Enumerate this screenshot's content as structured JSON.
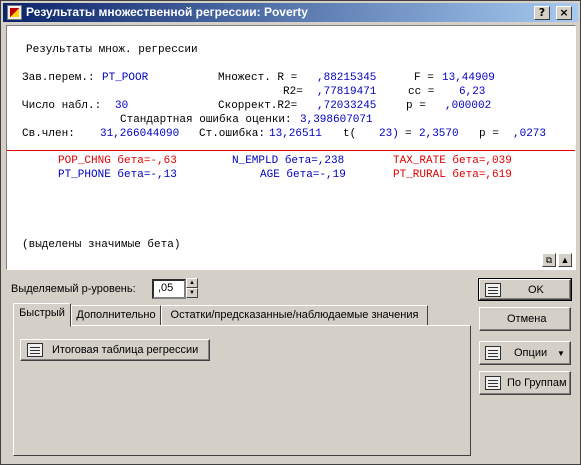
{
  "window": {
    "title": "Результаты множественной регрессии: Poverty"
  },
  "titlebar_buttons": {
    "help": "?",
    "close": "×"
  },
  "report": {
    "heading": "Результаты множ. регрессии",
    "dep_var_label": "Зав.перем.:",
    "dep_var_value": "PT_POOR",
    "multiple_r_label": "Множест. R =",
    "multiple_r_value": ",88215345",
    "f_label": "F =",
    "f_value": "13,44909",
    "r2_label": "R2=",
    "r2_value": ",77819471",
    "df_label": "cc =",
    "df_value": "6,23",
    "n_label": "Число набл.:",
    "n_value": "30",
    "adj_r2_label": "Скоррект.R2=",
    "adj_r2_value": ",72033245",
    "p_label": "p =",
    "p_value": ",000002",
    "std_err_label": "Стандартная ошибка оценки:",
    "std_err_value": "3,398607071",
    "intercept_label": "Св.член:",
    "intercept_value": "31,266044090",
    "intercept_se_label": "Ст.ошибка:",
    "intercept_se_value": "13,26511",
    "t_label": "t(",
    "t_df": "23)",
    "t_eq": "=",
    "t_value": "2,3570",
    "p2_label": "p =",
    "p2_value": ",0273",
    "betas_row1": [
      {
        "var": "POP_CHNG",
        "text": "бета=-,63",
        "significant": true
      },
      {
        "var": "N_EMPLD",
        "text": "бета=,238",
        "significant": false
      },
      {
        "var": "TAX_RATE",
        "text": "бета=,039",
        "significant": true
      }
    ],
    "betas_row2": [
      {
        "var": "PT_PHONE",
        "text": "бета=-,13",
        "significant": false
      },
      {
        "var": "AGE",
        "text": "бета=-,19",
        "significant": false
      },
      {
        "var": "PT_RURAL",
        "text": "бета=,619",
        "significant": true
      }
    ],
    "footnote": "(выделены значимые бета)"
  },
  "controls": {
    "p_level_label": "Выделяемый р-уровень:",
    "p_level_value": ",05",
    "spin_up": "▲",
    "spin_down": "▼",
    "copy_glyph": "⧉",
    "toggle_glyph": "▲"
  },
  "tabs": [
    {
      "label": "Быстрый",
      "active": true
    },
    {
      "label": "Дополнительно",
      "active": false
    },
    {
      "label": "Остатки/предсказанные/наблюдаемые значения",
      "active": false
    }
  ],
  "quick_tab": {
    "summary_button": "Итоговая таблица регрессии"
  },
  "buttons": {
    "ok": "OK",
    "cancel": "Отмена",
    "options": "Опции",
    "options_arrow": "▼",
    "by_groups": "По Группам"
  },
  "colors": {
    "significant": "#e00000",
    "normal": "#0000c0",
    "title_start": "#0a246a",
    "title_end": "#a6caf0"
  }
}
